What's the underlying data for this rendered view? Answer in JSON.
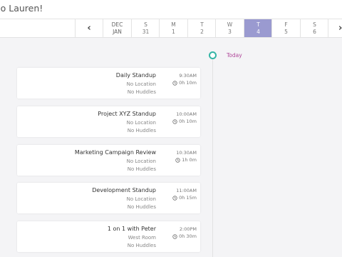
{
  "header": {
    "greeting": "ello Lauren!"
  },
  "week": {
    "month_top": "DEC",
    "month_bottom": "JAN",
    "prev_icon": "chevron-left-icon",
    "next_icon": "chevron-right-icon",
    "prev_glyph": "‹",
    "next_glyph": "›",
    "selected_color": "#9a9ad0",
    "days": [
      {
        "letter": "S",
        "num": "31",
        "selected": false
      },
      {
        "letter": "M",
        "num": "1",
        "selected": false
      },
      {
        "letter": "T",
        "num": "2",
        "selected": false
      },
      {
        "letter": "W",
        "num": "3",
        "selected": false
      },
      {
        "letter": "T",
        "num": "4",
        "selected": true
      },
      {
        "letter": "F",
        "num": "5",
        "selected": false
      },
      {
        "letter": "S",
        "num": "6",
        "selected": false
      }
    ]
  },
  "timeline": {
    "today_label": "Today",
    "dot_color": "#35b5a6",
    "label_color": "#b0479a"
  },
  "events": [
    {
      "title": "Daily Standup",
      "location": "No Location",
      "huddles": "No Huddles",
      "time": "9:30AM",
      "duration": "0h 10m"
    },
    {
      "title": "Project XYZ Standup",
      "location": "No Location",
      "huddles": "No Huddles",
      "time": "10:00AM",
      "duration": "0h 10m"
    },
    {
      "title": "Marketing Campaign Review",
      "location": "No Location",
      "huddles": "No Huddles",
      "time": "10:30AM",
      "duration": "1h 0m"
    },
    {
      "title": "Development Standup",
      "location": "No Location",
      "huddles": "No Huddles",
      "time": "11:00AM",
      "duration": "0h 15m"
    },
    {
      "title": "1 on 1 with Peter",
      "location": "West Room",
      "huddles": "No Huddles",
      "time": "2:00PM",
      "duration": "0h 30m"
    }
  ]
}
